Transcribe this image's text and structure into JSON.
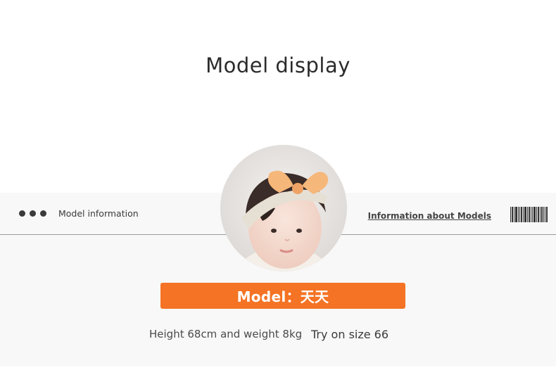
{
  "page_title": "Model display",
  "info_bar": {
    "left_label": "Model information",
    "right_label": "Information about Models",
    "dots_icon": "three-dots-icon",
    "barcode_icon": "barcode-icon"
  },
  "avatar": {
    "description_icon": "model-photo"
  },
  "model": {
    "name_label": "Model：天天",
    "stats": "Height 68cm and weight 8kg",
    "size": "Try on size 66"
  },
  "colors": {
    "accent": "#f47324",
    "panel": "#f8f8f8",
    "text": "#2b2b2b"
  }
}
